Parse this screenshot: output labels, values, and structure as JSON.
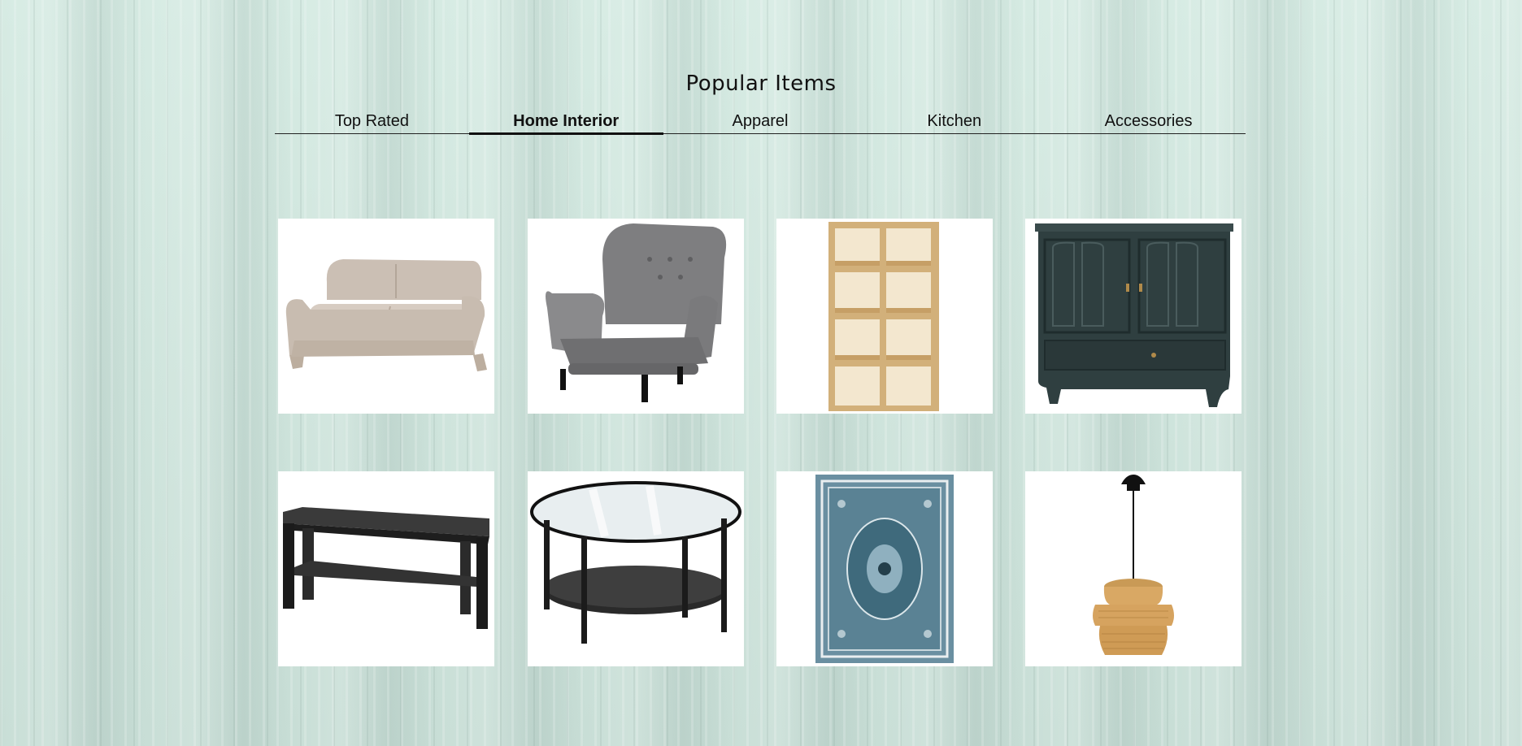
{
  "header": {
    "title": "Popular Items"
  },
  "tabs": [
    {
      "label": "Top Rated",
      "active": false
    },
    {
      "label": "Home Interior",
      "active": true
    },
    {
      "label": "Apparel",
      "active": false
    },
    {
      "label": "Kitchen",
      "active": false
    },
    {
      "label": "Accessories",
      "active": false
    }
  ],
  "products": [
    {
      "icon": "sofa-icon"
    },
    {
      "icon": "armchair-icon"
    },
    {
      "icon": "bookshelf-icon"
    },
    {
      "icon": "cabinet-icon"
    },
    {
      "icon": "tv-bench-icon"
    },
    {
      "icon": "coffee-table-icon"
    },
    {
      "icon": "rug-icon"
    },
    {
      "icon": "pendant-lamp-icon"
    }
  ]
}
